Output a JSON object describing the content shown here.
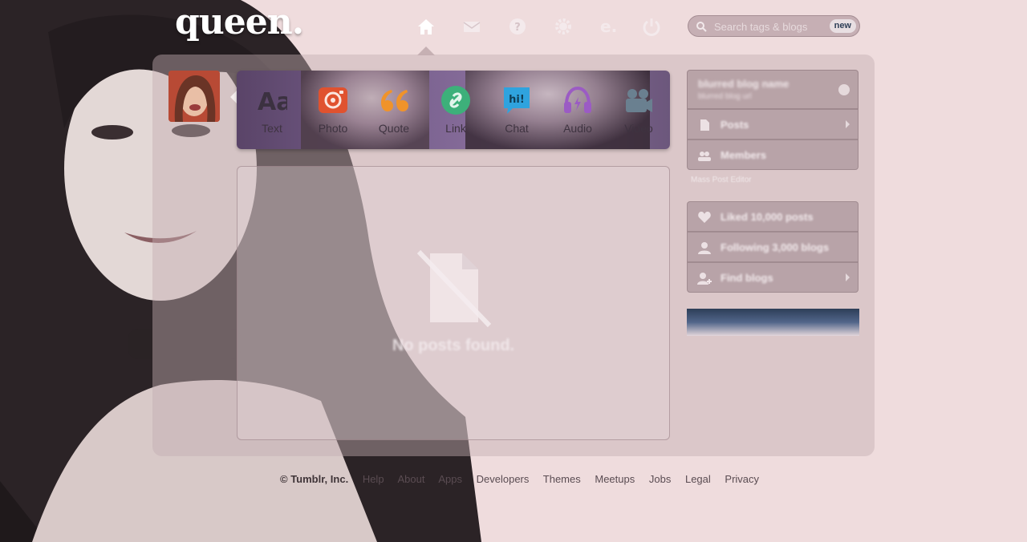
{
  "brand": {
    "logo": "queen."
  },
  "nav": {
    "items": [
      {
        "name": "home-icon"
      },
      {
        "name": "mail-icon"
      },
      {
        "name": "help-icon"
      },
      {
        "name": "settings-icon"
      },
      {
        "name": "explore-icon"
      },
      {
        "name": "power-icon"
      }
    ]
  },
  "search": {
    "placeholder": "Search tags & blogs",
    "badge": "new"
  },
  "post_types": [
    {
      "label": "Text",
      "icon": "text-icon"
    },
    {
      "label": "Photo",
      "icon": "camera-icon"
    },
    {
      "label": "Quote",
      "icon": "quote-icon"
    },
    {
      "label": "Link",
      "icon": "link-icon"
    },
    {
      "label": "Chat",
      "icon": "chat-icon",
      "icon_text": "hi!"
    },
    {
      "label": "Audio",
      "icon": "headphones-icon"
    },
    {
      "label": "Video",
      "icon": "video-camera-icon"
    }
  ],
  "feed": {
    "empty_message": "No posts found."
  },
  "sidebar": {
    "blog_name": "blurred blog name",
    "blog_url": "blurred blog url",
    "blog_links": [
      {
        "label": "Posts"
      },
      {
        "label": "Members"
      }
    ],
    "mass_post_editor": "Mass Post Editor",
    "account_links": [
      {
        "label": "Liked 10,000 posts"
      },
      {
        "label": "Following 3,000 blogs"
      },
      {
        "label": "Find blogs"
      }
    ]
  },
  "footer": {
    "copyright": "© Tumblr, Inc.",
    "links": [
      "Help",
      "About",
      "Apps",
      "Developers",
      "Themes",
      "Meetups",
      "Jobs",
      "Legal",
      "Privacy"
    ]
  },
  "colors": {
    "page_bg": "#efdcdd",
    "photo_orange": "#e0522f",
    "quote_orange": "#f0932a",
    "link_green": "#3db07a",
    "chat_blue": "#2fa3de",
    "audio_purple": "#9b5bc4",
    "video_slate": "#6a8090",
    "badge_text": "#2e3f57"
  }
}
